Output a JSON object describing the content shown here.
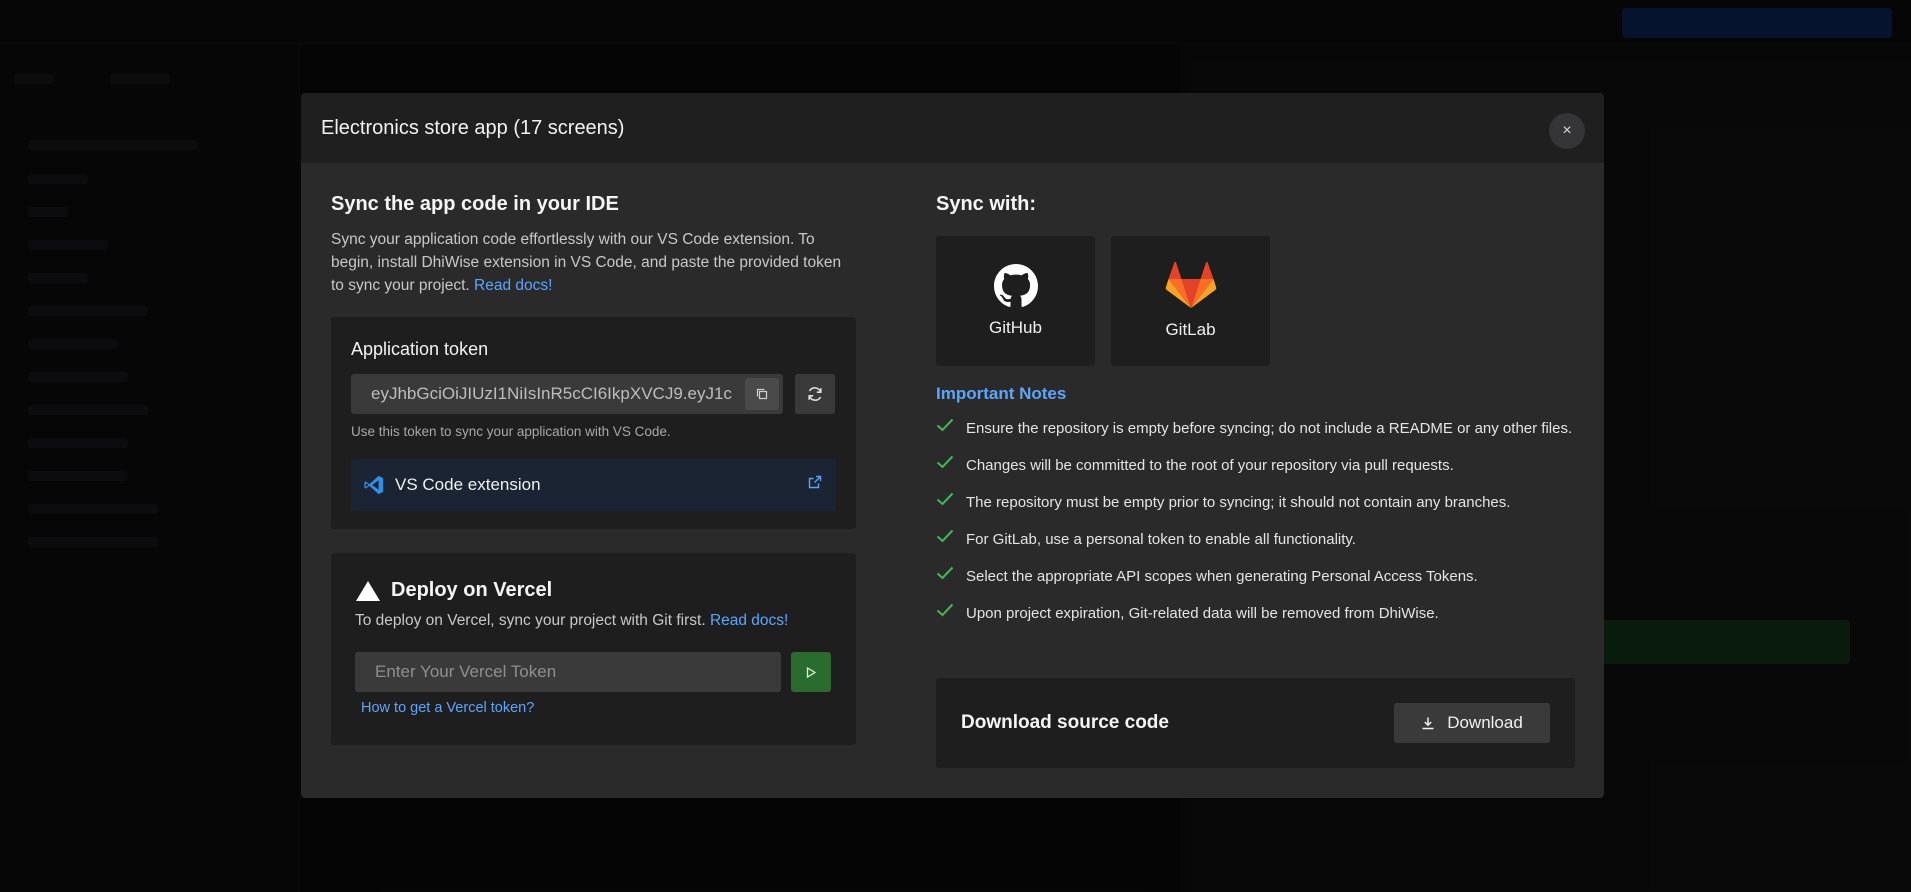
{
  "modal": {
    "title": "Electronics store app (17 screens)",
    "close_icon": "×"
  },
  "sync_ide": {
    "heading": "Sync the app code in your IDE",
    "description": "Sync your application code effortlessly with our VS Code extension. To begin, install DhiWise extension in VS Code, and paste the provided token to sync your project.",
    "read_docs": "Read docs",
    "read_docs_suffix": "!"
  },
  "token": {
    "title": "Application token",
    "value": "eyJhbGciOiJIUzI1NiIsInR5cCI6IkpXVCJ9.eyJ1c",
    "hint": "Use this token to sync your application with VS Code.",
    "vscode_label": "VS Code extension"
  },
  "vercel": {
    "title": "Deploy on Vercel",
    "description": "To deploy on Vercel, sync your project with Git first.",
    "read_docs": "Read docs!",
    "input_placeholder": "Enter Your Vercel Token",
    "help_link": "How to get a Vercel token?"
  },
  "sync_with": {
    "heading": "Sync with:",
    "providers": [
      {
        "label": "GitHub",
        "icon": "github-icon"
      },
      {
        "label": "GitLab",
        "icon": "gitlab-icon"
      }
    ]
  },
  "notes": {
    "title": "Important Notes",
    "items": [
      "Ensure the repository is empty before syncing; do not include a README or any other files.",
      "Changes will be committed to the root of your repository via pull requests.",
      "The repository must be empty prior to syncing; it should not contain any branches.",
      "For GitLab, use a personal token to enable all functionality.",
      "Select the appropriate API scopes when generating Personal Access Tokens.",
      "Upon project expiration, Git-related data will be removed from DhiWise."
    ]
  },
  "download": {
    "title": "Download source code",
    "button_label": "Download"
  },
  "colors": {
    "accent_link": "#5aa6ff",
    "check_green": "#3fb950",
    "go_button": "#2a6b2e"
  }
}
